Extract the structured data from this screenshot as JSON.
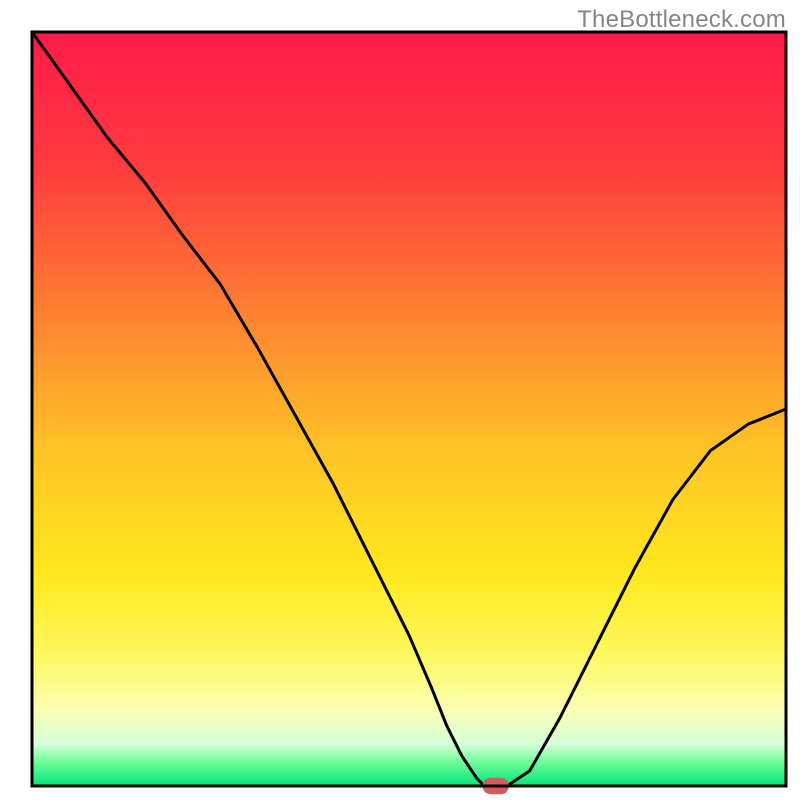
{
  "attribution": "TheBottleneck.com",
  "chart_data": {
    "type": "line",
    "title": "",
    "xlabel": "",
    "ylabel": "",
    "xlim": [
      0,
      100
    ],
    "ylim": [
      0,
      100
    ],
    "legend": false,
    "grid": false,
    "background_gradient": {
      "stops": [
        {
          "offset": 0.0,
          "color": "#ff1a49"
        },
        {
          "offset": 0.18,
          "color": "#ff3b3e"
        },
        {
          "offset": 0.36,
          "color": "#ff7c33"
        },
        {
          "offset": 0.55,
          "color": "#ffc226"
        },
        {
          "offset": 0.72,
          "color": "#ffe81d"
        },
        {
          "offset": 0.82,
          "color": "#fff75a"
        },
        {
          "offset": 0.9,
          "color": "#faffb4"
        },
        {
          "offset": 0.945,
          "color": "#d4ffd8"
        },
        {
          "offset": 0.965,
          "color": "#7bff9e"
        },
        {
          "offset": 1.0,
          "color": "#00e676"
        }
      ]
    },
    "frame": true,
    "series": [
      {
        "name": "bottleneck-curve",
        "color": "#000000",
        "stroke_width": 3,
        "x": [
          0,
          5,
          10,
          15,
          20,
          25,
          30,
          35,
          40,
          45,
          50,
          53,
          55,
          57,
          59,
          60,
          63,
          66,
          70,
          75,
          80,
          85,
          90,
          95,
          100
        ],
        "values": [
          100,
          93,
          86,
          80,
          73,
          66.5,
          58,
          49,
          40,
          30,
          20,
          13,
          8,
          4,
          1,
          0,
          0,
          2,
          9,
          19,
          29,
          38,
          44.5,
          48,
          50
        ]
      }
    ],
    "marker": {
      "name": "optimal-point",
      "x": 61.5,
      "y": 0,
      "width": 3.5,
      "height": 2.2,
      "rx": 1.1,
      "color": "#d65a5a"
    }
  }
}
